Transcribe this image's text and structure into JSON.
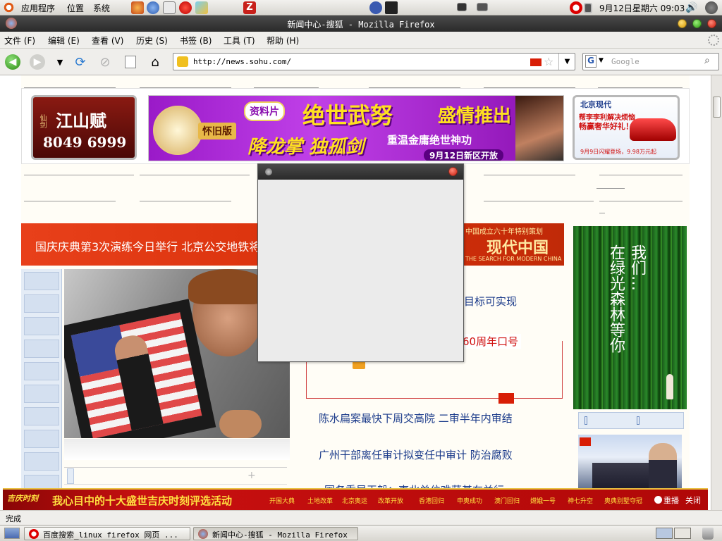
{
  "top_panel": {
    "menus": [
      "应用程序",
      "位置",
      "系统"
    ],
    "clock": "9月12日星期六 09:03"
  },
  "window": {
    "title": "新闻中心-搜狐 - Mozilla Firefox"
  },
  "menubar": {
    "items": [
      "文件 (F)",
      "编辑 (E)",
      "查看 (V)",
      "历史 (S)",
      "书签 (B)",
      "工具 (T)",
      "帮助 (H)"
    ]
  },
  "navbar": {
    "url": "http://news.sohu.com/",
    "search_placeholder": "Google",
    "search_engine_letter": "G"
  },
  "ads": {
    "left": {
      "line1": "江山赋",
      "line2": "8049 6999",
      "corner": "仙剑"
    },
    "center": {
      "edition": "怀旧版",
      "tag": "资料片",
      "headline": "绝世武努",
      "promo": "盛情推出",
      "calligraphy": "降龙掌 独孤剑",
      "tagline": "重温金庸绝世神功",
      "date": "9月12日新区开放"
    },
    "right": {
      "brand": "北京现代",
      "slogan1": "帮李李利解决烦恼",
      "slogan2": "畅赢奢华好礼！",
      "footer": "9月9日闪耀登场，9.98万元起"
    }
  },
  "scroll_banner": {
    "text": "国庆庆典第3次演练今日举行 北京公交地铁将",
    "special_tag": "中国成立六十年特别策划",
    "special_title": "现代中国",
    "special_sub": "THE SEARCH FOR MODERN CHINA"
  },
  "headlines": [
    "目标可实现",
    "60周年口号",
    "陈水扁案最快下周交高院  二审半年内审结",
    "广州干部离任审计拟变任中审计  防治腐败",
    "国务重局王毅：東北单位难获基在兰行"
  ],
  "green_ad": {
    "col1": "我们…",
    "col2": "在绿光森林等你"
  },
  "bottom_banner": {
    "logo": "吉庆时刻",
    "headline": "我心目中的十大盛世吉庆时刻评选活动",
    "items": [
      "开国大典",
      "土地改革",
      "北京奥运",
      "改革开放",
      "香港回归",
      "申奥成功",
      "澳门回归",
      "嫦娥一号",
      "神七升空",
      "奥典别墅夺冠"
    ],
    "replay": "重播",
    "close": "关闭"
  },
  "status": {
    "text": "完成"
  },
  "taskbar": {
    "items": [
      "百度搜索_linux firefox 网页 ...",
      "新闻中心-搜狐 - Mozilla Firefox"
    ]
  }
}
